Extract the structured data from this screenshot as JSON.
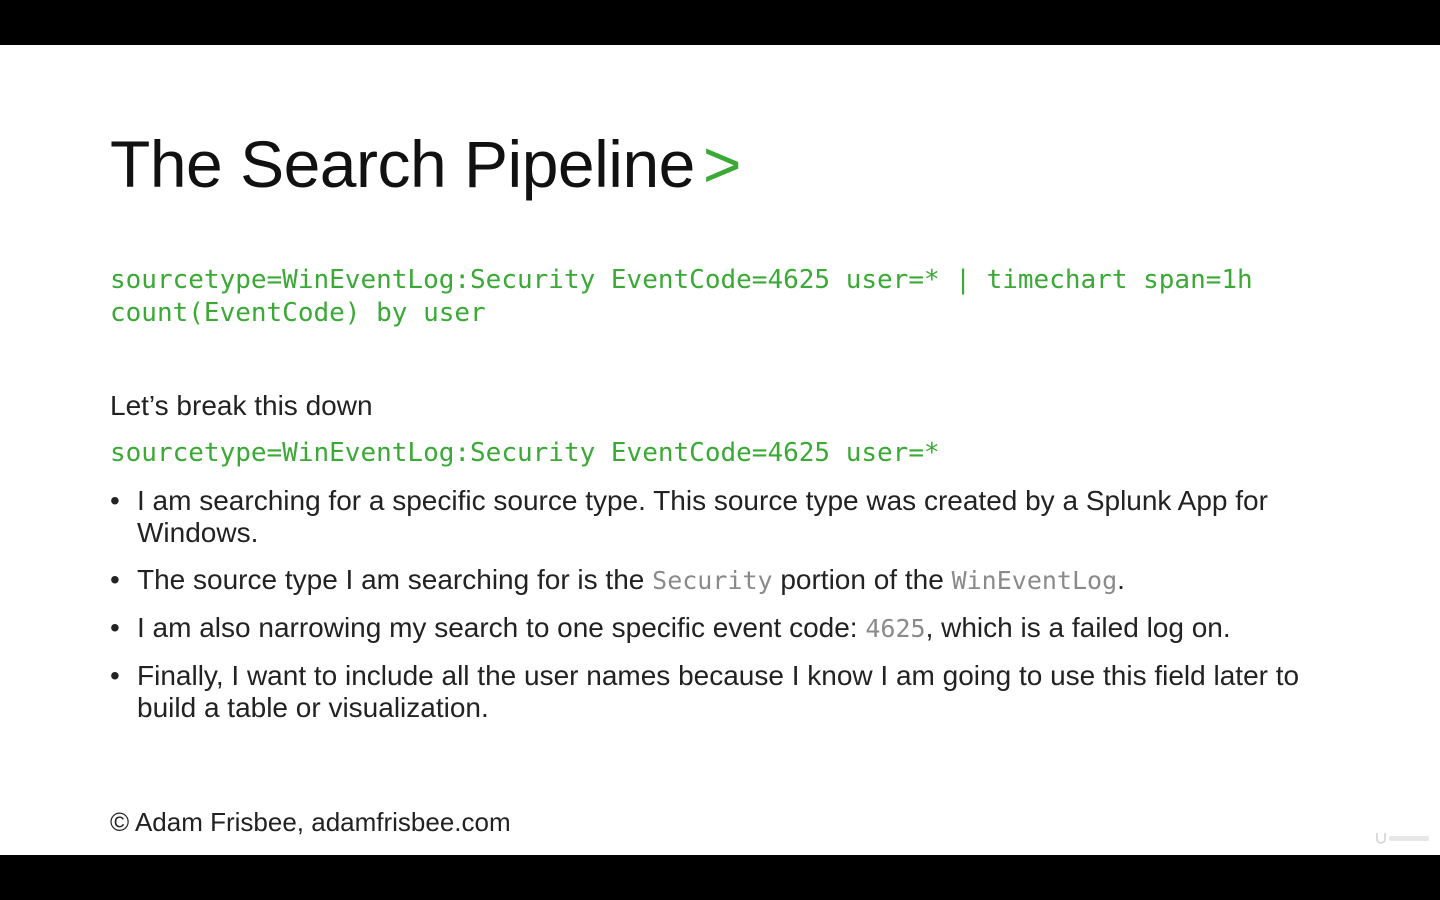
{
  "slide": {
    "title": "The Search Pipeline",
    "title_chevron": ">",
    "query_line1": "sourcetype=WinEventLog:Security EventCode=4625 user=* | timechart span=1h",
    "query_line2": "count(EventCode) by user",
    "intro": "Let’s break this down",
    "subquery": "sourcetype=WinEventLog:Security EventCode=4625 user=*",
    "bullets": [
      {
        "dot": "•",
        "text": "I am searching for a specific source type. This source type was created by a Splunk App for Windows."
      },
      {
        "dot": "•",
        "pre": "The source type I am searching for is the ",
        "code1": "Security",
        "mid": " portion of the ",
        "code2": "WinEventLog",
        "post": "."
      },
      {
        "dot": "•",
        "pre": "I am also narrowing my search to one specific event code: ",
        "code1": "4625",
        "post": ", which is a failed log on."
      },
      {
        "dot": "•",
        "text": "Finally, I want to include all the user names because I know I am going to use this field later to build a table or visualization."
      }
    ],
    "footer": "© Adam Frisbee, adamfrisbee.com",
    "watermark": "Udemy"
  },
  "colors": {
    "accent_green": "#3aa935",
    "inline_code_gray": "#8a8a8a",
    "text": "#222222",
    "background": "#ffffff",
    "letterbox": "#000000"
  }
}
